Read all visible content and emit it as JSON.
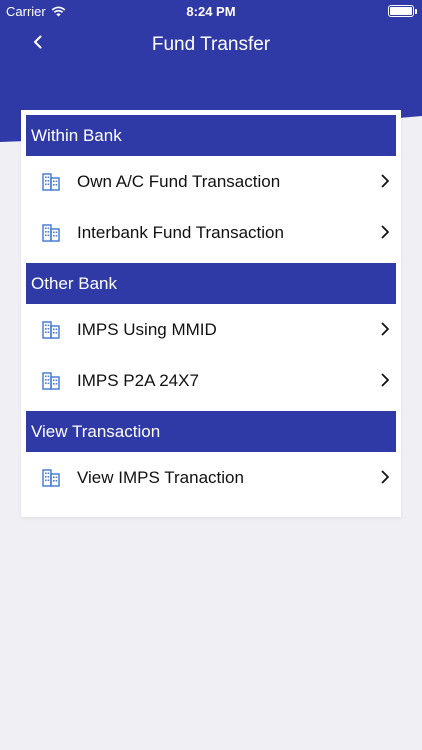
{
  "status_bar": {
    "carrier": "Carrier",
    "time": "8:24 PM"
  },
  "nav": {
    "title": "Fund Transfer",
    "back_icon": "chevron-left-icon"
  },
  "sections": [
    {
      "title": "Within Bank",
      "items": [
        {
          "label": "Own A/C Fund Transaction",
          "icon": "bank-building-icon"
        },
        {
          "label": "Interbank Fund Transaction",
          "icon": "bank-building-icon"
        }
      ]
    },
    {
      "title": "Other Bank",
      "items": [
        {
          "label": "IMPS Using MMID",
          "icon": "bank-building-icon"
        },
        {
          "label": "IMPS P2A 24X7",
          "icon": "bank-building-icon"
        }
      ]
    },
    {
      "title": "View Transaction",
      "items": [
        {
          "label": "View IMPS Tranaction",
          "icon": "bank-building-icon"
        }
      ]
    }
  ],
  "colors": {
    "primary": "#2f3aa6",
    "icon": "#4a7fd4",
    "background": "#efeff4"
  }
}
